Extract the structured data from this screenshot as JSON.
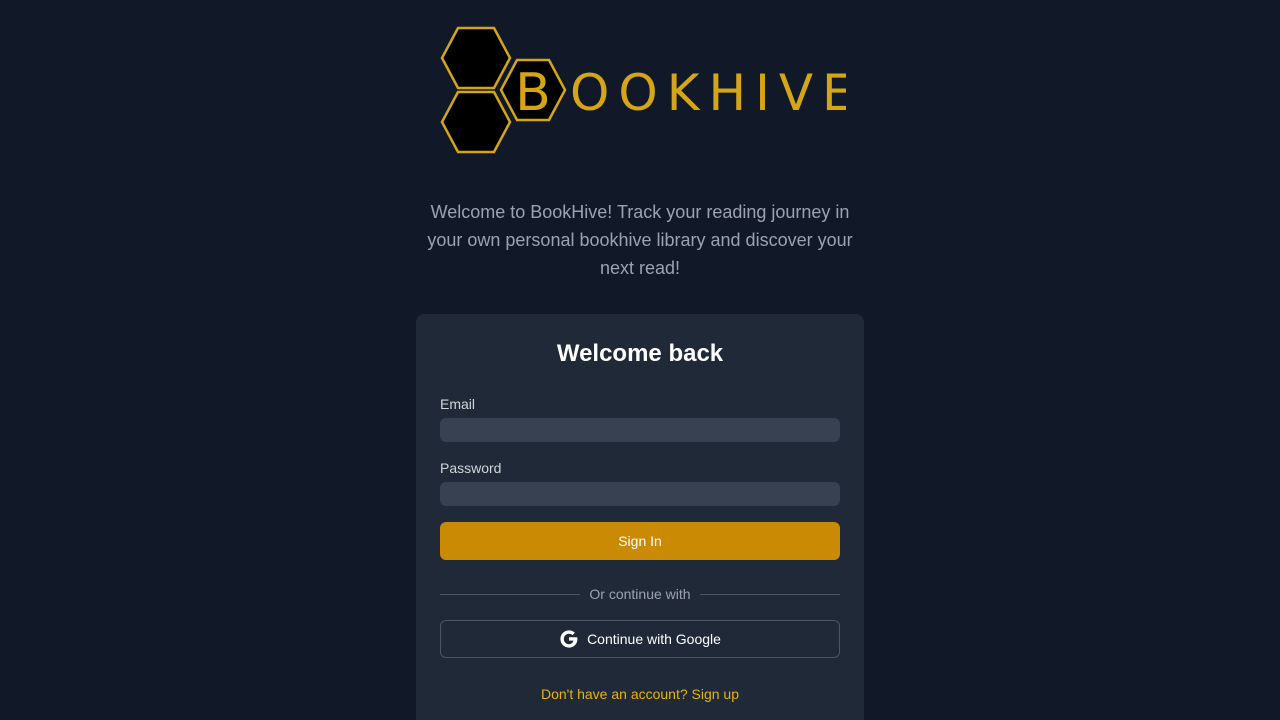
{
  "logo": {
    "letter": "B",
    "rest": "OOKHIVE",
    "color": "#d4a617"
  },
  "tagline": "Welcome to BookHive! Track your reading journey in your own personal bookhive library and discover your next read!",
  "login": {
    "title": "Welcome back",
    "email_label": "Email",
    "email_value": "",
    "password_label": "Password",
    "password_value": "",
    "signin_label": "Sign In",
    "divider_text": "Or continue with",
    "google_label": "Continue with Google",
    "google_icon": "google-icon",
    "signup_link": "Don't have an account? Sign up"
  },
  "colors": {
    "background": "#111827",
    "card": "#1f2937",
    "input": "#374151",
    "primary_button": "#ca8a04",
    "link": "#eab308"
  }
}
